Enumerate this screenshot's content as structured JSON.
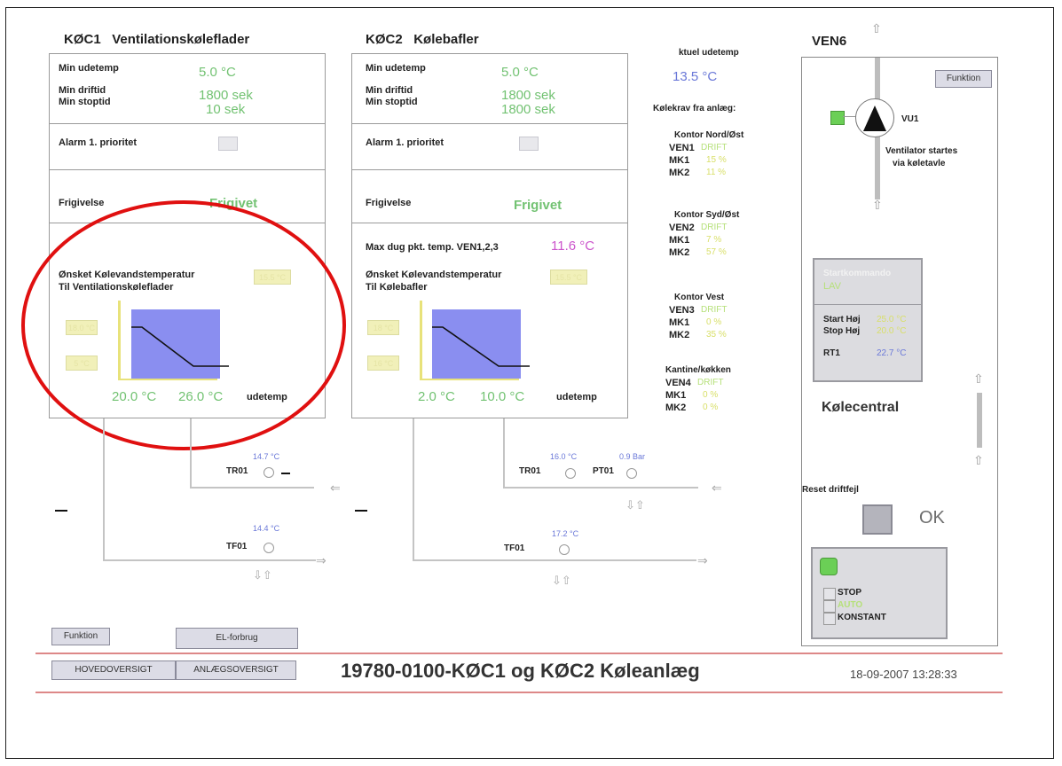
{
  "koc1": {
    "code": "KØC1",
    "name": "Ventilationskøleflader",
    "min_udetemp_label": "Min udetemp",
    "min_udetemp": "5.0 °C",
    "min_driftid_label": "Min driftid",
    "min_driftid": "1800 sek",
    "min_stoptid_label": "Min stoptid",
    "min_stoptid": "10 sek",
    "alarm_label": "Alarm 1. prioritet",
    "frigivelse_label": "Frigivelse",
    "frigivelse_value": "Frigivet",
    "onsket_line1": "Ønsket Kølevandstemperatur",
    "onsket_line2": "Til Ventilationskøleflader",
    "onsket_value": "15.5 °C",
    "curve_y_high": "18.0 °C",
    "curve_y_low": "5 °C",
    "x1": "20.0 °C",
    "x2": "26.0 °C",
    "xlabel": "udetemp"
  },
  "koc2": {
    "code": "KØC2",
    "name": "Kølebafler",
    "min_udetemp_label": "Min udetemp",
    "min_udetemp": "5.0 °C",
    "min_driftid_label": "Min driftid",
    "min_driftid": "1800 sek",
    "min_stoptid_label": "Min stoptid",
    "min_stoptid": "1800 sek",
    "alarm_label": "Alarm 1. prioritet",
    "frigivelse_label": "Frigivelse",
    "frigivelse_value": "Frigivet",
    "maxdug_label": "Max dug pkt. temp. VEN1,2,3",
    "maxdug_value": "11.6 °C",
    "onsket_line1": "Ønsket Kølevandstemperatur",
    "onsket_line2": "Til Kølebafler",
    "onsket_value": "15.5 °C",
    "curve_y_high": "18 °C",
    "curve_y_low": "16 °C",
    "x1": "2.0 °C",
    "x2": "10.0 °C",
    "xlabel": "udetemp"
  },
  "outdoor": {
    "label": "ktuel udetemp",
    "value": "13.5 °C",
    "kolekrav_label": "Kølekrav fra anlæg:"
  },
  "zones": [
    {
      "name": "Kontor Nord/Øst",
      "ven": "VEN1",
      "status": "DRIFT",
      "mk1": "15 %",
      "mk2": "11 %"
    },
    {
      "name": "Kontor Syd/Øst",
      "ven": "VEN2",
      "status": "DRIFT",
      "mk1": "7 %",
      "mk2": "57 %"
    },
    {
      "name": "Kontor Vest",
      "ven": "VEN3",
      "status": "DRIFT",
      "mk1": "0 %",
      "mk2": "35 %"
    },
    {
      "name": "Kantine/køkken",
      "ven": "VEN4",
      "status": "DRIFT",
      "mk1": "0 %",
      "mk2": "0 %"
    }
  ],
  "mk1_label": "MK1",
  "mk2_label": "MK2",
  "ven6": {
    "title": "VEN6",
    "funktion_btn": "Funktion",
    "fan_label": "VU1",
    "fan_note_line1": "Ventilator startes",
    "fan_note_line2": "via køletavle",
    "start_title": "Startkommando",
    "start_value": "LAV",
    "start_hoj_label": "Start Høj",
    "start_hoj_value": "25.0 °C",
    "stop_hoj_label": "Stop Høj",
    "stop_hoj_value": "20.0 °C",
    "rt1_label": "RT1",
    "rt1_value": "22.7 °C",
    "kolecentral": "Kølecentral",
    "reset_label": "Reset driftfejl",
    "ok_label": "OK",
    "mode_stop": "STOP",
    "mode_auto": "AUTO",
    "mode_konstant": "KONSTANT"
  },
  "sensors": {
    "tr01_left_value": "14.7 °C",
    "tr01_left_label": "TR01",
    "tf01_left_value": "14.4 °C",
    "tf01_left_label": "TF01",
    "tr01_right_value": "16.0 °C",
    "tr01_right_label": "TR01",
    "pt01_value": "0.9 Bar",
    "pt01_label": "PT01",
    "tf01_right_value": "17.2 °C",
    "tf01_right_label": "TF01"
  },
  "footer": {
    "funktion_btn": "Funktion",
    "el_btn": "EL-forbrug",
    "hoved_btn": "HOVEDOVERSIGT",
    "anlaeg_btn": "ANLÆGSOVERSIGT",
    "title": "19780-0100-KØC1 og KØC2 Køleanlæg",
    "datetime": "18-09-2007 13:28:33"
  },
  "colors": {
    "curve_fill": "#8a8ef0",
    "annotation": "#e01010",
    "value_green": "#72c272",
    "value_blue": "#6a78d8"
  }
}
